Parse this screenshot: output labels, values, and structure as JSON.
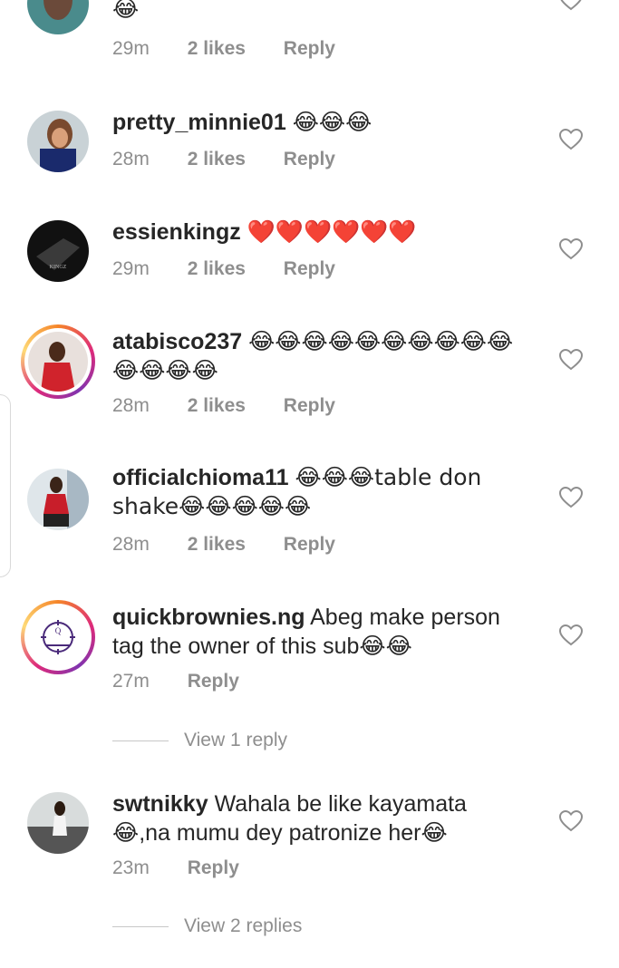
{
  "comments": [
    {
      "user": "",
      "text": "😂",
      "time": "29m",
      "likes": "2 likes",
      "reply": "Reply"
    },
    {
      "user": "pretty_minnie01",
      "text": "😂😂😂",
      "time": "28m",
      "likes": "2 likes",
      "reply": "Reply"
    },
    {
      "user": "essienkingz",
      "text": "❤️❤️❤️❤️❤️❤️",
      "time": "29m",
      "likes": "2 likes",
      "reply": "Reply"
    },
    {
      "user": "atabisco237",
      "text": "😂😂😂😂😂😂😂😂😂😂😂😂😂😂",
      "time": "28m",
      "likes": "2 likes",
      "reply": "Reply"
    },
    {
      "user": "officialchioma11",
      "text": "😂😂😂table don shake😂😂😂😂😂",
      "time": "28m",
      "likes": "2 likes",
      "reply": "Reply"
    },
    {
      "user": "quickbrownies.ng",
      "text": "Abeg make person tag the owner of this sub😂😂",
      "time": "27m",
      "reply": "Reply",
      "view_replies": "View 1 reply"
    },
    {
      "user": "swtnikky",
      "text": "Wahala be like kayamata 😂,na mumu dey patronize her😂",
      "time": "23m",
      "reply": "Reply",
      "view_replies": "View 2 replies"
    }
  ],
  "icons": {
    "like": "heart-outline-icon"
  },
  "colors": {
    "text": "#262626",
    "muted": "#8e8e8e",
    "story_ring": "#dd2a7b"
  }
}
